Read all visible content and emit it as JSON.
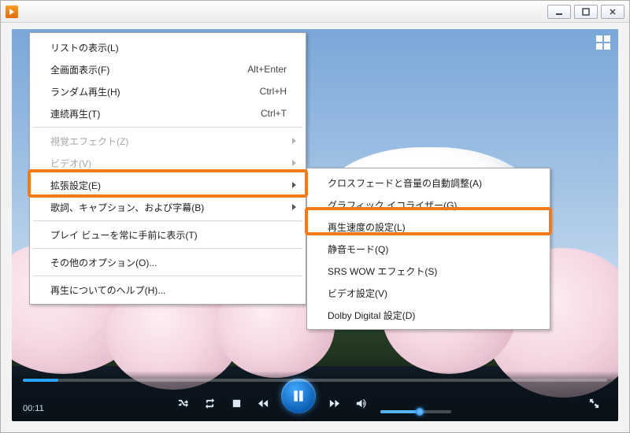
{
  "window": {
    "title": ""
  },
  "player": {
    "time_elapsed": "00:11"
  },
  "menu1": {
    "items": [
      {
        "label": "リストの表示(L)",
        "shortcut": "",
        "disabled": false,
        "submenu": false,
        "sepAfter": false
      },
      {
        "label": "全画面表示(F)",
        "shortcut": "Alt+Enter",
        "disabled": false,
        "submenu": false,
        "sepAfter": false
      },
      {
        "label": "ランダム再生(H)",
        "shortcut": "Ctrl+H",
        "disabled": false,
        "submenu": false,
        "sepAfter": false
      },
      {
        "label": "連続再生(T)",
        "shortcut": "Ctrl+T",
        "disabled": false,
        "submenu": false,
        "sepAfter": true
      },
      {
        "label": "視覚エフェクト(Z)",
        "shortcut": "",
        "disabled": true,
        "submenu": true,
        "sepAfter": false
      },
      {
        "label": "ビデオ(V)",
        "shortcut": "",
        "disabled": true,
        "submenu": true,
        "sepAfter": false
      },
      {
        "label": "拡張設定(E)",
        "shortcut": "",
        "disabled": false,
        "submenu": true,
        "sepAfter": false
      },
      {
        "label": "歌詞、キャプション、および字幕(B)",
        "shortcut": "",
        "disabled": false,
        "submenu": true,
        "sepAfter": true
      },
      {
        "label": "プレイ ビューを常に手前に表示(T)",
        "shortcut": "",
        "disabled": false,
        "submenu": false,
        "sepAfter": true
      },
      {
        "label": "その他のオプション(O)...",
        "shortcut": "",
        "disabled": false,
        "submenu": false,
        "sepAfter": true
      },
      {
        "label": "再生についてのヘルプ(H)...",
        "shortcut": "",
        "disabled": false,
        "submenu": false,
        "sepAfter": false
      }
    ]
  },
  "menu2": {
    "items": [
      {
        "label": "クロスフェードと音量の自動調整(A)"
      },
      {
        "label": "グラフィック イコライザー(G)"
      },
      {
        "label": "再生速度の設定(L)"
      },
      {
        "label": "静音モード(Q)"
      },
      {
        "label": "SRS WOW エフェクト(S)"
      },
      {
        "label": "ビデオ設定(V)"
      },
      {
        "label": "Dolby Digital 設定(D)"
      }
    ]
  },
  "highlights": {
    "menu1_index": 6,
    "menu2_index": 2
  }
}
